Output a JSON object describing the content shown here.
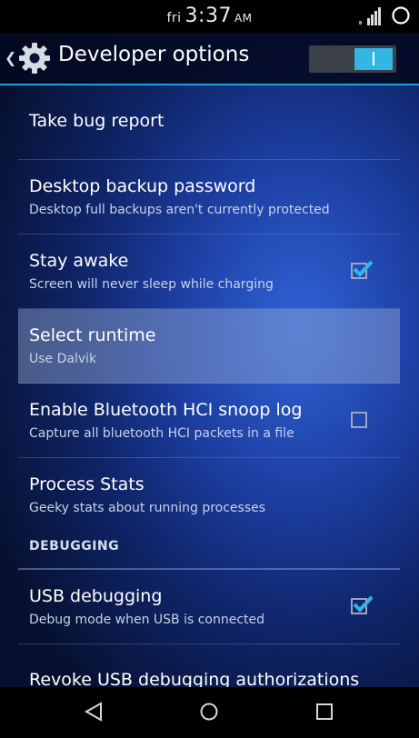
{
  "status_bar": {
    "day": "fri",
    "time": "3:37",
    "ampm": "AM"
  },
  "action_bar": {
    "title": "Developer options",
    "toggle_label": "I",
    "toggle_on": true
  },
  "items": [
    {
      "title": "Take bug report",
      "summary": "",
      "checkbox": null,
      "highlighted": false
    },
    {
      "title": "Desktop backup password",
      "summary": "Desktop full backups aren't currently protected",
      "checkbox": null,
      "highlighted": false
    },
    {
      "title": "Stay awake",
      "summary": "Screen will never sleep while charging",
      "checkbox": true,
      "highlighted": false
    },
    {
      "title": "Select runtime",
      "summary": "Use Dalvik",
      "checkbox": null,
      "highlighted": true
    },
    {
      "title": "Enable Bluetooth HCI snoop log",
      "summary": "Capture all bluetooth HCI packets in a file",
      "checkbox": false,
      "highlighted": false
    },
    {
      "title": "Process Stats",
      "summary": "Geeky stats about running processes",
      "checkbox": null,
      "highlighted": false
    }
  ],
  "debugging": {
    "header": "DEBUGGING",
    "items": [
      {
        "title": "USB debugging",
        "summary": "Debug mode when USB is connected",
        "checkbox": true
      },
      {
        "title": "Revoke USB debugging authorizations",
        "summary": "",
        "checkbox": null
      }
    ]
  },
  "colors": {
    "accent": "#33b5e5",
    "divider": "#1aa3d6",
    "status_bar_bg": "#000000"
  },
  "icons": {
    "signal": "signal-icon",
    "battery": "battery-icon",
    "settings": "gear-icon",
    "back": "back-icon",
    "home": "home-icon",
    "recents": "recents-icon"
  }
}
